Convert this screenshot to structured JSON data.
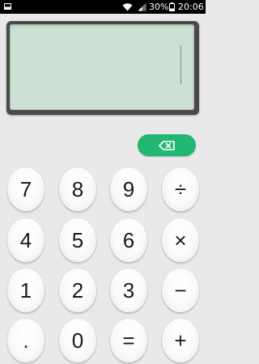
{
  "status_bar": {
    "battery_percent": "30%",
    "time": "20:06",
    "icons": [
      "notification-icon",
      "wifi-icon",
      "signal-icon",
      "battery-icon"
    ]
  },
  "display": {
    "value": ""
  },
  "backspace": {
    "icon": "backspace-icon",
    "color": "#22b873"
  },
  "keys": {
    "k7": "7",
    "k8": "8",
    "k9": "9",
    "divide": "÷",
    "k4": "4",
    "k5": "5",
    "k6": "6",
    "multiply": "×",
    "k1": "1",
    "k2": "2",
    "k3": "3",
    "minus": "−",
    "dot": ".",
    "k0": "0",
    "equals": "=",
    "plus": "+"
  },
  "colors": {
    "background": "#e9e9e9",
    "lcd": "#cde0d4",
    "frame": "#4a4a4a",
    "accent": "#22b873"
  }
}
